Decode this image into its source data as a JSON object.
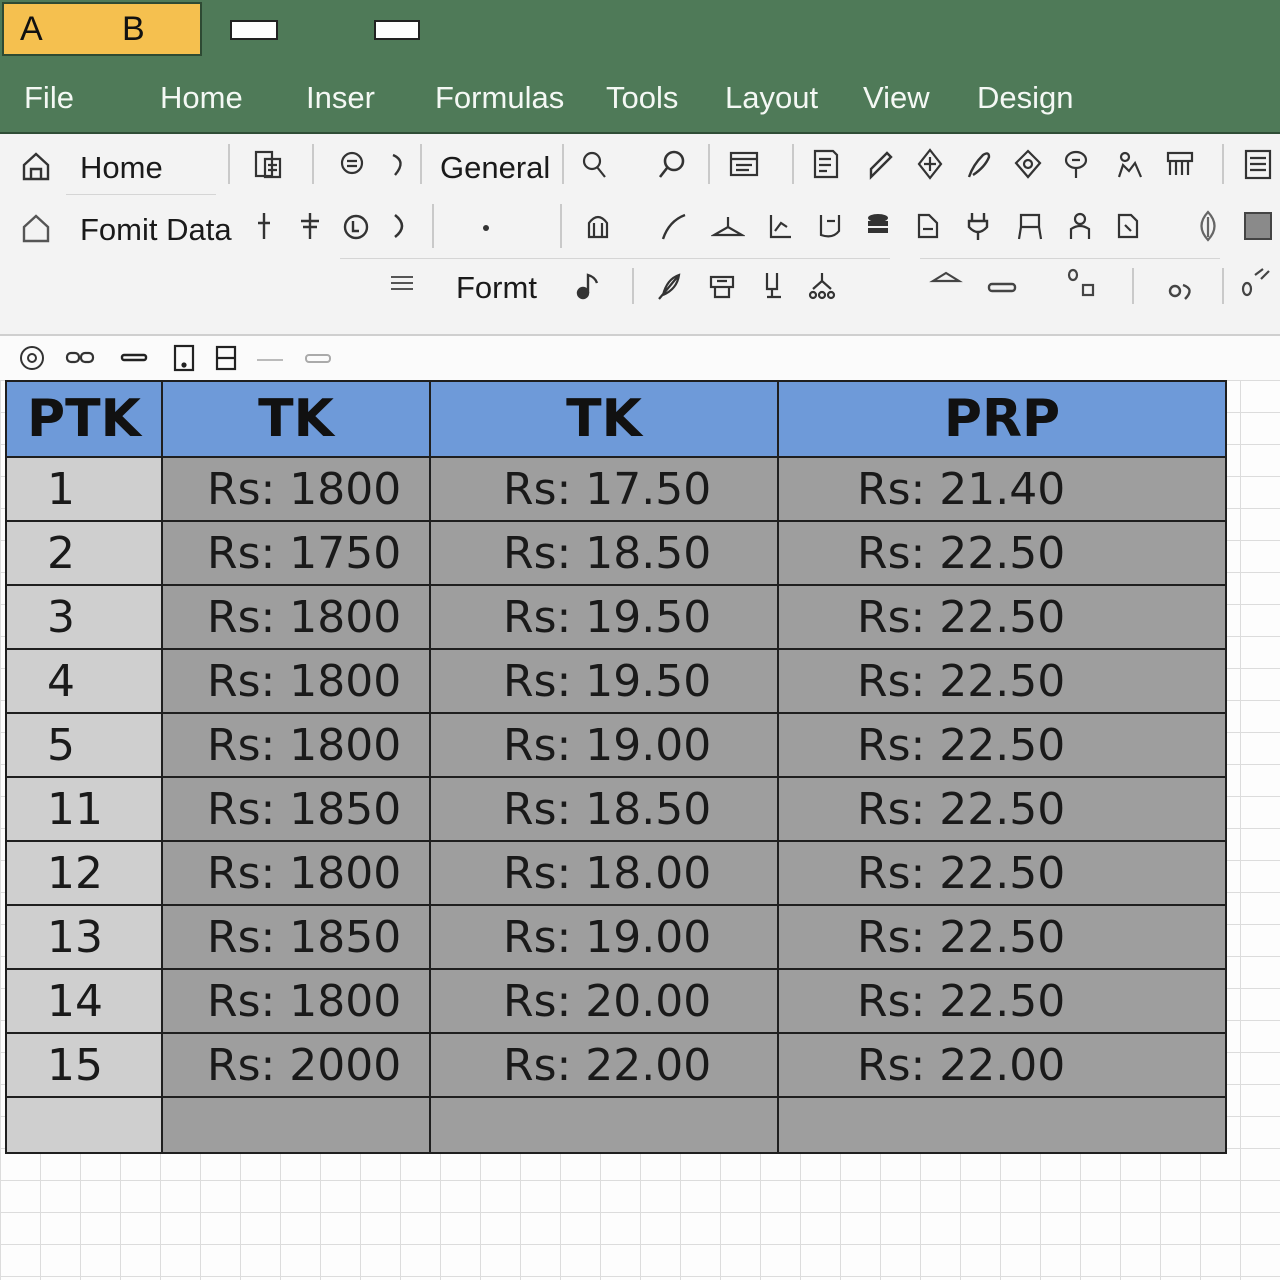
{
  "name_box": {
    "col_a": "A",
    "col_b": "B"
  },
  "menu": [
    "File",
    "Home",
    "Inser",
    "Formulas",
    "Tools",
    "Layout",
    "View",
    "Design"
  ],
  "ribbon": {
    "row1_home": "Home",
    "row1_general": "General",
    "row2_label": "Fomit Data",
    "row3_label": "Formt"
  },
  "colors": {
    "titlebar": "#4f7a58",
    "name_box": "#f5c04f",
    "header_fill": "#6e9ad9",
    "cell_fill": "#9e9e9e",
    "index_fill": "#cfcfcf"
  },
  "table": {
    "headers": [
      "PTK",
      "TK",
      "TK",
      "PRP"
    ],
    "rows": [
      [
        "1",
        "Rs:  1800",
        "Rs:  17.50",
        "Rs:  21.40"
      ],
      [
        "2",
        "Rs:  1750",
        "Rs:  18.50",
        "Rs:  22.50"
      ],
      [
        "3",
        "Rs:  1800",
        "Rs:  19.50",
        "Rs:  22.50"
      ],
      [
        "4",
        "Rs:  1800",
        "Rs:  19.50",
        "Rs:  22.50"
      ],
      [
        "5",
        "Rs:  1800",
        "Rs:  19.00",
        "Rs:  22.50"
      ],
      [
        "11",
        "Rs:  1850",
        "Rs:  18.50",
        "Rs:  22.50"
      ],
      [
        "12",
        "Rs:  1800",
        "Rs:  18.00",
        "Rs:  22.50"
      ],
      [
        "13",
        "Rs:  1850",
        "Rs:  19.00",
        "Rs:  22.50"
      ],
      [
        "14",
        "Rs:  1800",
        "Rs:  20.00",
        "Rs:  22.50"
      ],
      [
        "15",
        "Rs:  2000",
        "Rs:  22.00",
        "Rs:  22.00"
      ]
    ]
  }
}
